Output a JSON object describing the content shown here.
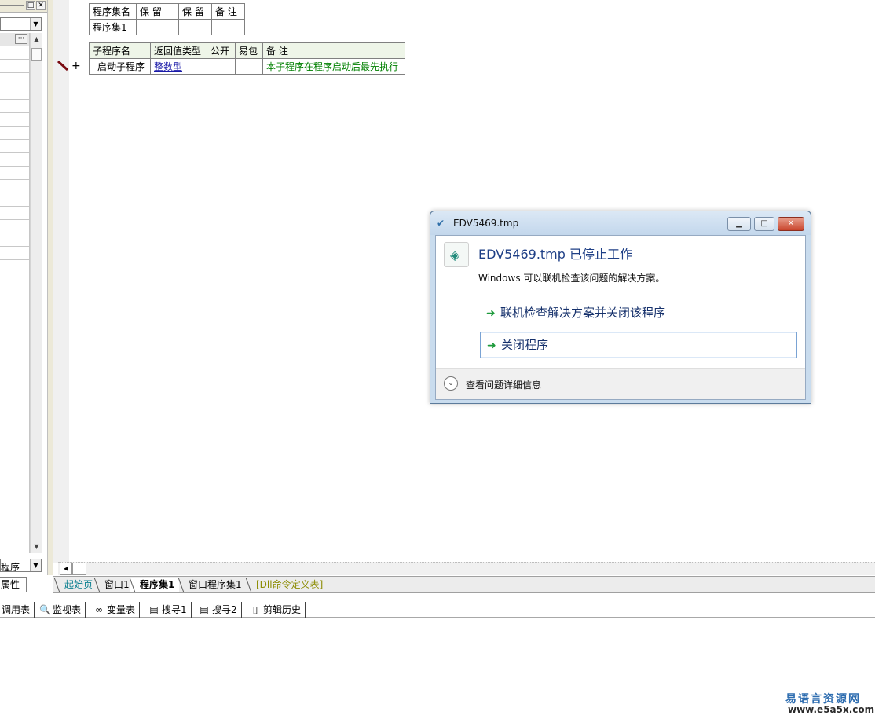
{
  "left_panel": {
    "bottom_combo_value": "程序",
    "properties_tab_label": "属性"
  },
  "assembly_table": {
    "headers": [
      "程序集名",
      "保 留",
      "保 留",
      "备 注"
    ],
    "row": [
      "程序集1",
      "",
      "",
      ""
    ]
  },
  "subroutine_table": {
    "headers": [
      "子程序名",
      "返回值类型",
      "公开",
      "易包",
      "备 注"
    ],
    "row": {
      "name": "_启动子程序",
      "return_type": "整数型",
      "public": "",
      "easy_pkg": "",
      "note": "本子程序在程序启动后最先执行"
    },
    "expand_symbol": "+"
  },
  "doc_tabs": [
    "起始页",
    "窗口1",
    "程序集1",
    "窗口程序集1",
    "[Dll命令定义表]"
  ],
  "bottom_toolbar": [
    "调用表",
    "监视表",
    "变量表",
    "搜寻1",
    "搜寻2",
    "剪辑历史"
  ],
  "dialog": {
    "title": "EDV5469.tmp",
    "heading": "EDV5469.tmp 已停止工作",
    "subtext": "Windows 可以联机检查该问题的解决方案。",
    "option_check_online": "联机检查解决方案并关闭该程序",
    "option_close": "关闭程序",
    "details": "查看问题详细信息"
  },
  "watermark": {
    "title": "易语言资源网",
    "url": "www.e5a5x.com"
  },
  "colors": {
    "link_blue": "#1a1aa8",
    "note_green": "#008000",
    "dialog_heading": "#1e3f86",
    "arrow_green": "#1d9a3b"
  }
}
